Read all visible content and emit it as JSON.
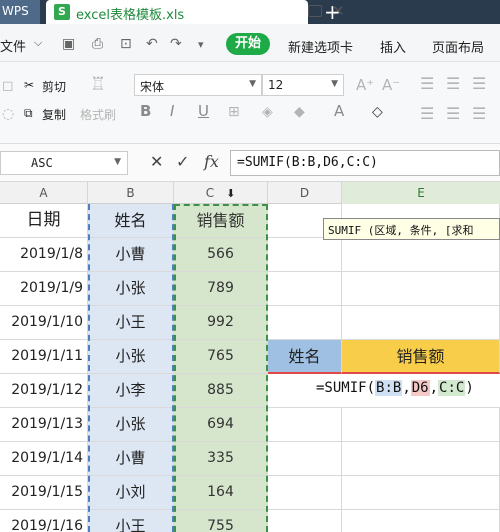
{
  "titlebar": {
    "app_tab": "WPS",
    "file_tab": "excel表格模板.xls",
    "file_icon": "S",
    "new_tab_label": "+"
  },
  "menu": {
    "file": "文件",
    "start": "开始",
    "items": [
      "新建选项卡",
      "插入",
      "页面布局"
    ]
  },
  "ribbon": {
    "cut": "剪切",
    "copy": "复制",
    "format_painter": "格式刷",
    "font_name": "宋体",
    "font_size": "12",
    "bold": "B",
    "italic": "I",
    "underline": "U",
    "font_color_letter": "A",
    "fill_letter": "A"
  },
  "formula_bar": {
    "name_box": "ASC",
    "cancel": "✕",
    "confirm": "✓",
    "fx": "fx",
    "formula": "=SUMIF(B:B,D6,C:C)"
  },
  "columns": [
    "A",
    "B",
    "C",
    "D",
    "E"
  ],
  "headers": {
    "a": "日期",
    "b": "姓名",
    "c": "销售额"
  },
  "rows": [
    {
      "date": "2019/1/8",
      "name": "小曹",
      "sales": "566"
    },
    {
      "date": "2019/1/9",
      "name": "小张",
      "sales": "789"
    },
    {
      "date": "2019/1/10",
      "name": "小王",
      "sales": "992"
    },
    {
      "date": "2019/1/11",
      "name": "小张",
      "sales": "765"
    },
    {
      "date": "2019/1/12",
      "name": "小李",
      "sales": "885"
    },
    {
      "date": "2019/1/13",
      "name": "小张",
      "sales": "694"
    },
    {
      "date": "2019/1/14",
      "name": "小曹",
      "sales": "335"
    },
    {
      "date": "2019/1/15",
      "name": "小刘",
      "sales": "164"
    },
    {
      "date": "2019/1/16",
      "name": "小王",
      "sales": "755"
    }
  ],
  "lookup": {
    "name_label": "姓名",
    "sales_label": "销售额"
  },
  "edit": {
    "prefix": "=SUMIF(",
    "ref_b": "B:B",
    "sep1": ",",
    "ref_d": "D6",
    "sep2": ",",
    "ref_c": "C:C",
    "suffix": ")"
  },
  "tooltip": "SUMIF (区域, 条件, [求和"
}
